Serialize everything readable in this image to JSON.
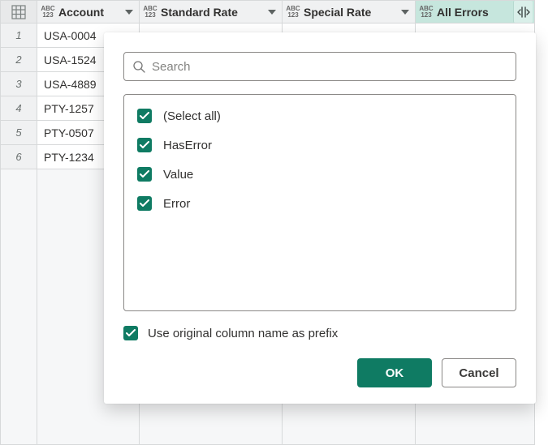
{
  "columns": {
    "account": "Account",
    "standardRate": "Standard Rate",
    "specialRate": "Special Rate",
    "allErrors": "All Errors"
  },
  "typeIcon": {
    "abc": "ABC",
    "num": "123"
  },
  "rows": {
    "r1": {
      "num": "1",
      "account": "USA-0004"
    },
    "r2": {
      "num": "2",
      "account": "USA-1524"
    },
    "r3": {
      "num": "3",
      "account": "USA-4889"
    },
    "r4": {
      "num": "4",
      "account": "PTY-1257"
    },
    "r5": {
      "num": "5",
      "account": "PTY-0507"
    },
    "r6": {
      "num": "6",
      "account": "PTY-1234"
    }
  },
  "dialog": {
    "searchPlaceholder": "Search",
    "options": {
      "selectAll": "(Select all)",
      "hasError": "HasError",
      "value": "Value",
      "error": "Error"
    },
    "prefixLabel": "Use original column name as prefix",
    "okLabel": "OK",
    "cancelLabel": "Cancel"
  }
}
